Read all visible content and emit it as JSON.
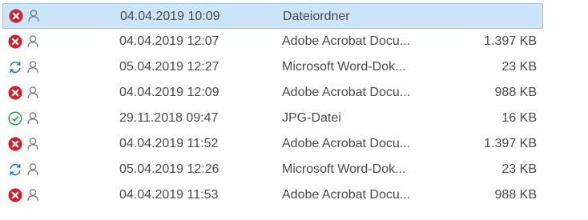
{
  "colors": {
    "error": "#d0202a",
    "sync": "#1e7bcf",
    "ok": "#23a040",
    "person": "#7a7a7a",
    "selection": "#cce4f7"
  },
  "files": [
    {
      "status": "error-icon",
      "date": "04.04.2019 10:09",
      "type": "Dateiordner",
      "size": ""
    },
    {
      "status": "error-icon",
      "date": "04.04.2019 12:07",
      "type": "Adobe Acrobat Docu...",
      "size": "1.397 KB"
    },
    {
      "status": "sync-icon",
      "date": "05.04.2019 12:27",
      "type": "Microsoft Word-Dok...",
      "size": "23 KB"
    },
    {
      "status": "error-icon",
      "date": "04.04.2019 12:09",
      "type": "Adobe Acrobat Docu...",
      "size": "988 KB"
    },
    {
      "status": "synced-check-icon",
      "date": "29.11.2018 09:47",
      "type": "JPG-Datei",
      "size": "16 KB"
    },
    {
      "status": "error-icon",
      "date": "04.04.2019 11:52",
      "type": "Adobe Acrobat Docu...",
      "size": "1.397 KB"
    },
    {
      "status": "sync-icon",
      "date": "05.04.2019 12:26",
      "type": "Microsoft Word-Dok...",
      "size": "23 KB"
    },
    {
      "status": "error-icon",
      "date": "04.04.2019 11:53",
      "type": "Adobe Acrobat Docu...",
      "size": "988 KB"
    }
  ]
}
